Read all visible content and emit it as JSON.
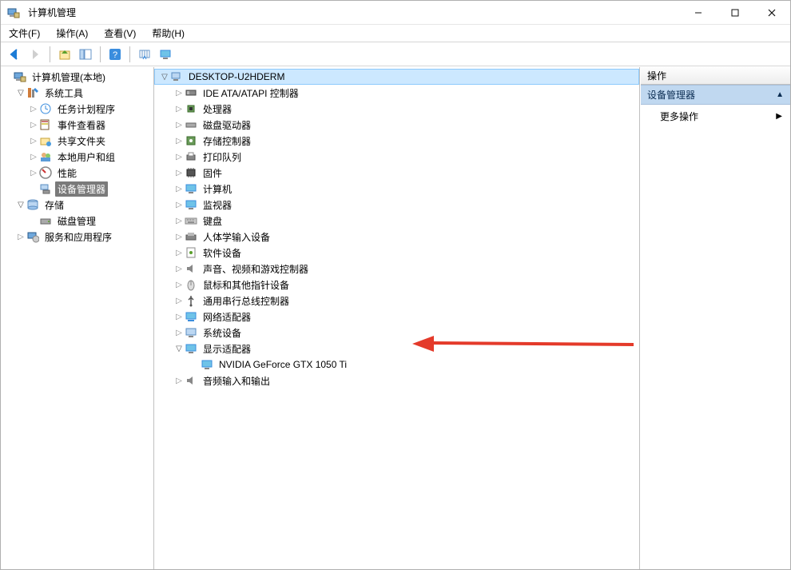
{
  "window": {
    "title": "计算机管理"
  },
  "menu": {
    "file": "文件(F)",
    "action": "操作(A)",
    "view": "查看(V)",
    "help": "帮助(H)"
  },
  "left_tree": {
    "root": "计算机管理(本地)",
    "system_tools": "系统工具",
    "task_scheduler": "任务计划程序",
    "event_viewer": "事件查看器",
    "shared_folders": "共享文件夹",
    "local_users": "本地用户和组",
    "performance": "性能",
    "device_manager": "设备管理器",
    "storage": "存储",
    "disk_mgmt": "磁盘管理",
    "services_apps": "服务和应用程序"
  },
  "device_tree": {
    "computer": "DESKTOP-U2HDERM",
    "ide": "IDE ATA/ATAPI 控制器",
    "cpu": "处理器",
    "disk_drive": "磁盘驱动器",
    "storage_ctrl": "存储控制器",
    "print_queue": "打印队列",
    "firmware": "固件",
    "computer_cat": "计算机",
    "monitor": "监视器",
    "keyboard": "键盘",
    "hid": "人体学输入设备",
    "software_dev": "软件设备",
    "sound": "声音、视频和游戏控制器",
    "mouse": "鼠标和其他指针设备",
    "usb": "通用串行总线控制器",
    "network": "网络适配器",
    "system_dev": "系统设备",
    "display": "显示适配器",
    "gpu": "NVIDIA GeForce GTX 1050 Ti",
    "audio_io": "音频输入和输出"
  },
  "right": {
    "header": "操作",
    "section": "设备管理器",
    "more_actions": "更多操作"
  }
}
